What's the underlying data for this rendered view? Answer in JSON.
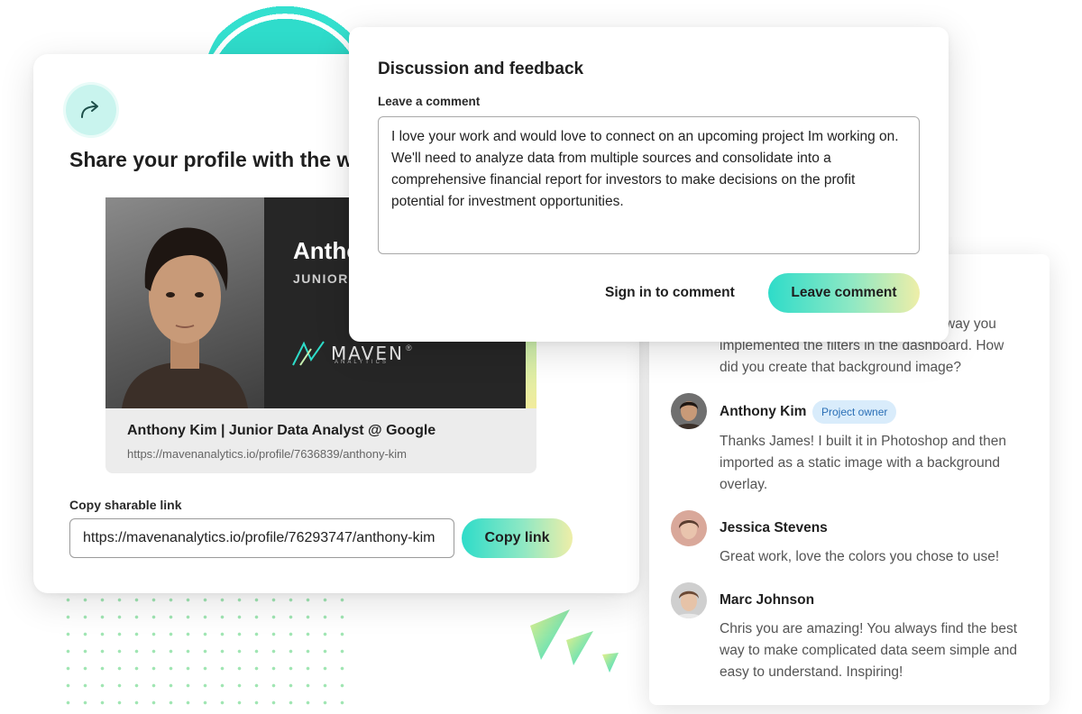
{
  "share": {
    "title": "Share your profile with the world",
    "profile_card": {
      "name_overlay": "Anthony Kim",
      "role_overlay": "JUNIOR DATA ANALYST",
      "logo_word": "MAVEN",
      "logo_registered": "®",
      "logo_sub": "ANALYTICS",
      "title": "Anthony Kim | Junior Data Analyst @ Google",
      "url": "https://mavenanalytics.io/profile/7636839/anthony-kim"
    },
    "copy_label": "Copy sharable link",
    "copy_value": "https://mavenanalytics.io/profile/76293747/anthony-kim",
    "copy_button": "Copy link"
  },
  "discussion": {
    "title": "Discussion and feedback",
    "comment_label": "Leave a comment",
    "comment_value": "I love your work and would love to connect on an upcoming project Im working on. We'll need to analyze data from multiple sources and consolidate into a comprehensive financial report for investors to make decisions on the profit potential for investment opportunities.",
    "sign_in": "Sign in to comment",
    "leave_button": "Leave comment"
  },
  "comments": {
    "partial_text": "way you implemented the filters in the dashboard. How did you create that background image?",
    "partial_line1": "way you",
    "partial_line2": "implemented the filters in the dashboard. How",
    "partial_line3": "did you create that background image?",
    "items": [
      {
        "name": "Anthony Kim",
        "badge": "Project owner",
        "text": "Thanks James! I built it in Photoshop and then imported as a static image with a background overlay."
      },
      {
        "name": "Jessica Stevens",
        "text": "Great work, love the colors you chose to use!"
      },
      {
        "name": "Marc Johnson",
        "text": "Chris you are amazing! You always find the best way to make complicated data seem simple and easy to understand. Inspiring!"
      }
    ]
  },
  "colors": {
    "accent_teal": "#2edcc9",
    "accent_yellow": "#eeeea8",
    "badge_bg": "#d9ecfb",
    "badge_text": "#2a6fb6"
  }
}
